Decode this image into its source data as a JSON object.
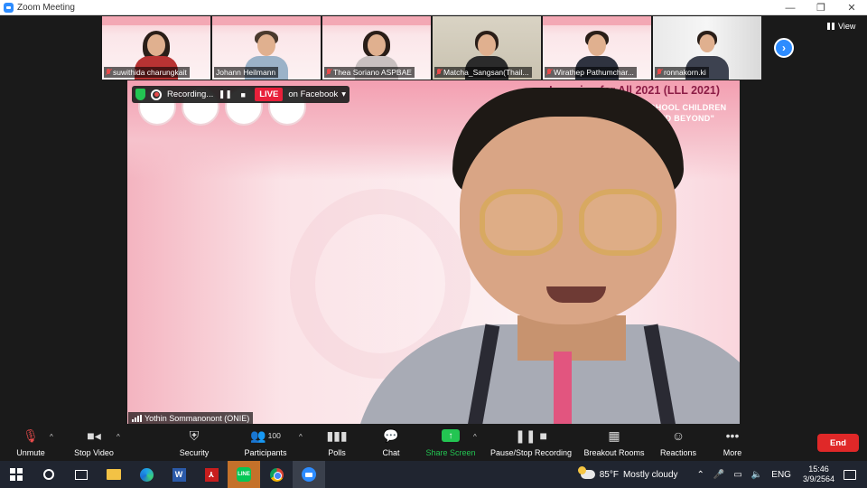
{
  "window": {
    "title": "Zoom Meeting",
    "controls": {
      "minimize": "—",
      "restore": "❐",
      "close": "✕"
    }
  },
  "view_button": {
    "label": "View"
  },
  "participants_strip": [
    {
      "name": "suwithida charungkait",
      "muted": true
    },
    {
      "name": "Johann Heilmann",
      "muted": false
    },
    {
      "name": "Thea Soriano ASPBAE",
      "muted": true
    },
    {
      "name": "Matcha_Sangsan(Thail...",
      "muted": true
    },
    {
      "name": "Wirathep Pathumchar...",
      "muted": true
    },
    {
      "name": "ronnakorn.ki",
      "muted": true
    }
  ],
  "next_page_icon": "chevron-right-icon",
  "recording_bar": {
    "status": "Recording...",
    "live_label": "LIVE",
    "destination": "on Facebook"
  },
  "main_video": {
    "speaker_name": "Yothin Sommanonont (ONIE)",
    "banner_title": "g Learning for All 2021 (LLL 2021)",
    "banner_line1": "RNING FOR OUT-OF SCHOOL CHILDREN",
    "banner_line2": "IN THE COVID-19 CRISIS AND BEYOND\""
  },
  "toolbar": {
    "unmute": "Unmute",
    "stop_video": "Stop Video",
    "security": "Security",
    "participants": "Participants",
    "participants_count": "100",
    "polls": "Polls",
    "chat": "Chat",
    "share_screen": "Share Screen",
    "pause_stop_recording": "Pause/Stop Recording",
    "breakout_rooms": "Breakout Rooms",
    "reactions": "Reactions",
    "more": "More",
    "end": "End"
  },
  "taskbar": {
    "weather_temp": "85°F",
    "weather_desc": "Mostly cloudy",
    "language": "ENG",
    "time": "15:46",
    "date": "3/9/2564",
    "word_letter": "W",
    "line_label": "LINE"
  },
  "colors": {
    "zoom_blue": "#2d8cff",
    "live_red": "#e8203a",
    "share_green": "#23c552",
    "end_red": "#e02828"
  }
}
